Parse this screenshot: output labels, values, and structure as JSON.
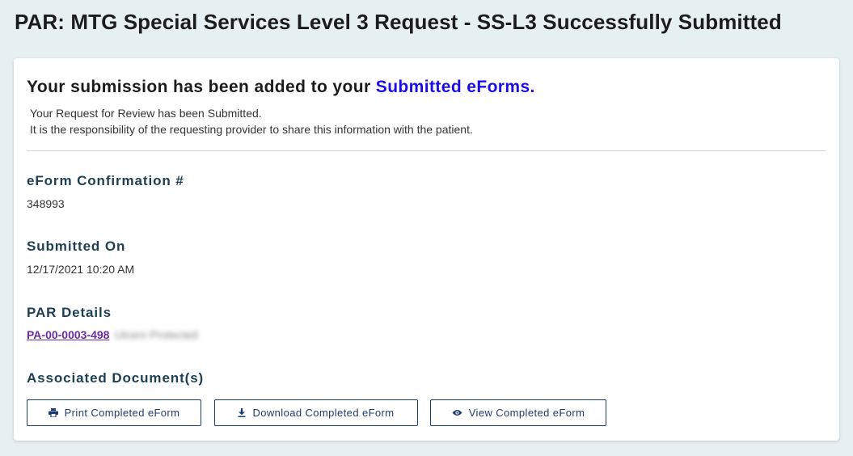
{
  "page": {
    "title": "PAR: MTG Special Services Level 3 Request - SS-L3 Successfully Submitted"
  },
  "confirmation": {
    "headline_prefix": "Your submission has been added to your ",
    "headline_link": "Submitted eForms.",
    "message_line1": "Your Request for Review has been Submitted.",
    "message_line2": "It is the responsibility of the requesting provider to share this information with the patient."
  },
  "fields": {
    "confirmation_label": "eForm Confirmation #",
    "confirmation_value": "348993",
    "submitted_on_label": "Submitted On",
    "submitted_on_value": "12/17/2021 10:20 AM",
    "par_details_label": "PAR Details",
    "par_link": "PA-00-0003-498",
    "par_blurred_text": "Ulcers Protected",
    "documents_label": "Associated Document(s)"
  },
  "buttons": {
    "print_label": "Print Completed eForm",
    "download_label": "Download Completed eForm",
    "view_label": "View Completed eForm"
  },
  "icons": {
    "print": "printer-icon",
    "download": "download-icon",
    "view": "eye-icon"
  },
  "colors": {
    "page_background": "#e6f0f2",
    "link_blue": "#1a0dea",
    "par_link_purple": "#6a2aa5",
    "label_teal": "#1d3f52",
    "button_navy": "#1f3c6e"
  }
}
